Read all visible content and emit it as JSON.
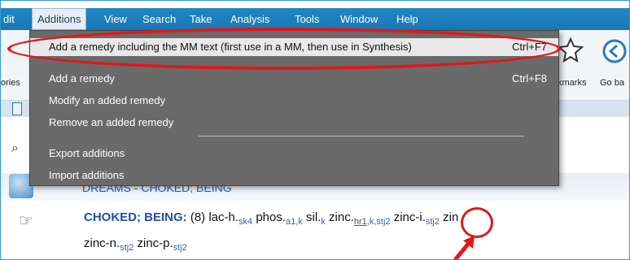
{
  "menubar": {
    "items": [
      "dit",
      "Additions",
      "View",
      "Search",
      "Take",
      "Analysis",
      "Tools",
      "Window",
      "Help"
    ],
    "active": "Additions"
  },
  "toolbar": {
    "left_partial_label": "ories",
    "bookmarks_label": "kmarks",
    "goback_label": "Go ba"
  },
  "dropdown": {
    "items": [
      {
        "label": "Add a remedy including the MM text (first use in a MM, then use in Synthesis)",
        "shortcut": "Ctrl+F7"
      },
      {
        "label": "Add a remedy",
        "shortcut": "Ctrl+F8"
      },
      {
        "label": "Modify an added remedy",
        "shortcut": ""
      },
      {
        "label": "Remove an added remedy",
        "shortcut": ""
      },
      {
        "label": "Export additions",
        "shortcut": ""
      },
      {
        "label": "Import additions",
        "shortcut": ""
      }
    ]
  },
  "header": {
    "text": "DREAMS - CHOKED; BEING"
  },
  "rubric": {
    "title": "CHOKED; BEING:",
    "count": "(8)",
    "remedies_line1": [
      {
        "name": "lac-h.",
        "sub": "sk4"
      },
      {
        "name": "phos.",
        "sub": "a1,k"
      },
      {
        "name": "sil.",
        "sub": "k"
      },
      {
        "name": "zinc.",
        "sub_link": "hr1",
        "sub": ",k,stj2"
      },
      {
        "name": "zinc-i.",
        "sub": "stj2"
      },
      {
        "name": "zin",
        "sub": ""
      }
    ],
    "remedies_line2": [
      {
        "name": "zinc-n.",
        "sub": "stj2"
      },
      {
        "name": "zinc-p.",
        "sub": "stj2"
      }
    ]
  },
  "annotation_color": "#e01818"
}
